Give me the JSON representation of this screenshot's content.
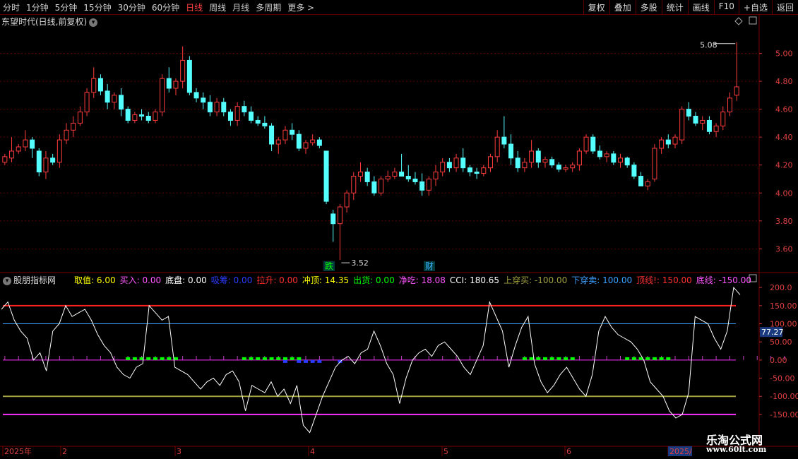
{
  "toolbar": {
    "periods": [
      "分时",
      "1分钟",
      "5分钟",
      "15分钟",
      "30分钟",
      "60分钟",
      "日线",
      "周线",
      "月线",
      "多周期",
      "更多"
    ],
    "active_period": "日线",
    "more_arrow": ">",
    "right_buttons": [
      "复权",
      "叠加",
      "多股",
      "统计",
      "画线",
      "F10",
      "+自选",
      "返回"
    ]
  },
  "stock": {
    "title": "东望时代(日线,前复权)",
    "dropdown_icon": "chevron-down-icon"
  },
  "price_panel": {
    "y_labels": [
      "5.00",
      "4.80",
      "4.60",
      "4.40",
      "4.20",
      "4.00",
      "3.80",
      "3.60"
    ],
    "y_values": [
      5.0,
      4.8,
      4.6,
      4.4,
      4.2,
      4.0,
      3.8,
      3.6
    ],
    "high_label": "5.08",
    "low_label": "3.52",
    "markers": [
      {
        "text": "跌",
        "color": "#00ff00"
      },
      {
        "text": "财",
        "color": "#3ab0ff"
      }
    ],
    "colors": {
      "up": "#ff3c3c",
      "down": "#54ffff",
      "grid": "#5a0000"
    }
  },
  "indicator": {
    "name": "股朋指标网",
    "fields": [
      {
        "label": "取值:",
        "value": "6.00",
        "color": "#ffff00"
      },
      {
        "label": "买入:",
        "value": "0.00",
        "color": "#ff55ff"
      },
      {
        "label": "底盘:",
        "value": "0.00",
        "color": "#ffffff"
      },
      {
        "label": "吸筹:",
        "value": "0.00",
        "color": "#2b3bff"
      },
      {
        "label": "拉升:",
        "value": "0.00",
        "color": "#ff3030"
      },
      {
        "label": "冲顶:",
        "value": "14.35",
        "color": "#ffff00"
      },
      {
        "label": "出货:",
        "value": "0.00",
        "color": "#00ff00"
      },
      {
        "label": "净吃:",
        "value": "18.08",
        "color": "#ff55ff"
      },
      {
        "label": "CCI:",
        "value": "180.65",
        "color": "#ffffff"
      },
      {
        "label": "上穿买:",
        "value": "-100.00",
        "color": "#a0a040"
      },
      {
        "label": "下穿卖:",
        "value": "100.00",
        "color": "#3aa0ff"
      },
      {
        "label": "顶线!:",
        "value": "150.00",
        "color": "#ff3030"
      },
      {
        "label": "底线:",
        "value": "-150.00",
        "color": "#ff55ff"
      }
    ],
    "y_labels": [
      "200.0",
      "150.00",
      "100.00",
      "50.00",
      "0.00",
      "-50.00",
      "-100.00",
      "-150.00"
    ],
    "y_values": [
      200,
      150,
      100,
      50,
      0,
      -50,
      -100,
      -150
    ],
    "current_cci_label": "77.27",
    "colors": {
      "top_line": "#ff2020",
      "sell_line": "#3aa0ff",
      "buy_line": "#a0a040",
      "bottom_line": "#ff30ff",
      "cci": "#ffffff"
    }
  },
  "x_axis": {
    "labels": [
      "2025年",
      "2",
      "3",
      "4",
      "5",
      "6",
      "2025/"
    ]
  },
  "watermark": {
    "line1": "乐淘公式网",
    "line2": "www.60lt.com"
  },
  "chart_data": [
    {
      "type": "candlestick",
      "title": "东望时代(日线,前复权)",
      "ylim": [
        3.45,
        5.2
      ],
      "candles": [
        [
          4.22,
          4.28,
          4.2,
          4.26
        ],
        [
          4.25,
          4.4,
          4.22,
          4.3
        ],
        [
          4.3,
          4.35,
          4.28,
          4.33
        ],
        [
          4.33,
          4.45,
          4.3,
          4.38
        ],
        [
          4.38,
          4.4,
          4.25,
          4.32
        ],
        [
          4.3,
          4.32,
          4.12,
          4.15
        ],
        [
          4.15,
          4.3,
          4.1,
          4.25
        ],
        [
          4.25,
          4.28,
          4.2,
          4.22
        ],
        [
          4.22,
          4.42,
          4.18,
          4.38
        ],
        [
          4.38,
          4.5,
          4.35,
          4.45
        ],
        [
          4.45,
          4.55,
          4.4,
          4.5
        ],
        [
          4.5,
          4.62,
          4.48,
          4.58
        ],
        [
          4.58,
          4.75,
          4.55,
          4.72
        ],
        [
          4.72,
          4.9,
          4.68,
          4.82
        ],
        [
          4.82,
          4.85,
          4.7,
          4.73
        ],
        [
          4.73,
          4.78,
          4.6,
          4.65
        ],
        [
          4.65,
          4.72,
          4.6,
          4.7
        ],
        [
          4.7,
          4.75,
          4.55,
          4.6
        ],
        [
          4.6,
          4.62,
          4.5,
          4.52
        ],
        [
          4.52,
          4.58,
          4.5,
          4.56
        ],
        [
          4.56,
          4.6,
          4.52,
          4.55
        ],
        [
          4.55,
          4.58,
          4.5,
          4.52
        ],
        [
          4.52,
          4.6,
          4.5,
          4.58
        ],
        [
          4.58,
          4.85,
          4.55,
          4.82
        ],
        [
          4.82,
          4.9,
          4.72,
          4.75
        ],
        [
          4.75,
          4.82,
          4.7,
          4.8
        ],
        [
          4.8,
          5.05,
          4.75,
          4.95
        ],
        [
          4.95,
          4.98,
          4.7,
          4.72
        ],
        [
          4.72,
          4.75,
          4.65,
          4.68
        ],
        [
          4.68,
          4.72,
          4.6,
          4.65
        ],
        [
          4.65,
          4.7,
          4.55,
          4.58
        ],
        [
          4.58,
          4.68,
          4.55,
          4.65
        ],
        [
          4.65,
          4.68,
          4.55,
          4.58
        ],
        [
          4.58,
          4.6,
          4.48,
          4.52
        ],
        [
          4.52,
          4.65,
          4.48,
          4.62
        ],
        [
          4.62,
          4.66,
          4.55,
          4.58
        ],
        [
          4.58,
          4.62,
          4.5,
          4.52
        ],
        [
          4.52,
          4.55,
          4.48,
          4.5
        ],
        [
          4.5,
          4.55,
          4.46,
          4.48
        ],
        [
          4.48,
          4.5,
          4.3,
          4.35
        ],
        [
          4.35,
          4.4,
          4.28,
          4.38
        ],
        [
          4.38,
          4.48,
          4.35,
          4.45
        ],
        [
          4.45,
          4.5,
          4.38,
          4.42
        ],
        [
          4.42,
          4.45,
          4.3,
          4.32
        ],
        [
          4.32,
          4.38,
          4.28,
          4.36
        ],
        [
          4.36,
          4.42,
          4.34,
          4.38
        ],
        [
          4.38,
          4.4,
          4.32,
          4.34
        ],
        [
          4.3,
          4.3,
          3.92,
          3.94
        ],
        [
          3.85,
          3.88,
          3.65,
          3.78
        ],
        [
          3.78,
          3.92,
          3.52,
          3.9
        ],
        [
          3.9,
          4.02,
          3.86,
          4.0
        ],
        [
          4.0,
          4.15,
          3.95,
          4.12
        ],
        [
          4.12,
          4.22,
          4.08,
          4.15
        ],
        [
          4.15,
          4.18,
          4.05,
          4.08
        ],
        [
          4.08,
          4.12,
          3.98,
          4.0
        ],
        [
          4.0,
          4.12,
          3.98,
          4.1
        ],
        [
          4.1,
          4.16,
          4.08,
          4.12
        ],
        [
          4.12,
          4.18,
          4.1,
          4.15
        ],
        [
          4.15,
          4.28,
          4.12,
          4.12
        ],
        [
          4.12,
          4.2,
          4.08,
          4.1
        ],
        [
          4.1,
          4.15,
          4.06,
          4.08
        ],
        [
          4.08,
          4.14,
          3.98,
          4.02
        ],
        [
          4.02,
          4.12,
          3.98,
          4.1
        ],
        [
          4.1,
          4.2,
          4.05,
          4.15
        ],
        [
          4.15,
          4.25,
          4.12,
          4.22
        ],
        [
          4.22,
          4.25,
          4.15,
          4.18
        ],
        [
          4.18,
          4.28,
          4.15,
          4.25
        ],
        [
          4.25,
          4.32,
          4.15,
          4.18
        ],
        [
          4.18,
          4.2,
          4.12,
          4.15
        ],
        [
          4.15,
          4.18,
          4.1,
          4.14
        ],
        [
          4.14,
          4.2,
          4.12,
          4.18
        ],
        [
          4.18,
          4.28,
          4.15,
          4.26
        ],
        [
          4.26,
          4.45,
          4.22,
          4.4
        ],
        [
          4.4,
          4.55,
          4.32,
          4.35
        ],
        [
          4.35,
          4.42,
          4.2,
          4.25
        ],
        [
          4.25,
          4.3,
          4.15,
          4.18
        ],
        [
          4.18,
          4.25,
          4.15,
          4.22
        ],
        [
          4.22,
          4.38,
          4.18,
          4.3
        ],
        [
          4.3,
          4.32,
          4.18,
          4.22
        ],
        [
          4.22,
          4.26,
          4.18,
          4.24
        ],
        [
          4.24,
          4.26,
          4.18,
          4.2
        ],
        [
          4.2,
          4.22,
          4.15,
          4.17
        ],
        [
          4.17,
          4.2,
          4.15,
          4.18
        ],
        [
          4.18,
          4.22,
          4.15,
          4.2
        ],
        [
          4.2,
          4.32,
          4.16,
          4.3
        ],
        [
          4.3,
          4.42,
          4.28,
          4.4
        ],
        [
          4.4,
          4.42,
          4.28,
          4.3
        ],
        [
          4.3,
          4.34,
          4.24,
          4.26
        ],
        [
          4.26,
          4.3,
          4.22,
          4.28
        ],
        [
          4.28,
          4.3,
          4.2,
          4.22
        ],
        [
          4.22,
          4.28,
          4.18,
          4.25
        ],
        [
          4.25,
          4.26,
          4.18,
          4.2
        ],
        [
          4.2,
          4.22,
          4.1,
          4.12
        ],
        [
          4.12,
          4.15,
          4.05,
          4.05
        ],
        [
          4.05,
          4.1,
          4.02,
          4.08
        ],
        [
          4.1,
          4.35,
          4.08,
          4.32
        ],
        [
          4.32,
          4.4,
          4.28,
          4.38
        ],
        [
          4.38,
          4.42,
          4.32,
          4.35
        ],
        [
          4.35,
          4.42,
          4.32,
          4.4
        ],
        [
          4.38,
          4.62,
          4.35,
          4.6
        ],
        [
          4.6,
          4.65,
          4.52,
          4.55
        ],
        [
          4.55,
          4.58,
          4.48,
          4.5
        ],
        [
          4.5,
          4.55,
          4.45,
          4.52
        ],
        [
          4.52,
          4.55,
          4.42,
          4.44
        ],
        [
          4.44,
          4.5,
          4.4,
          4.48
        ],
        [
          4.48,
          4.62,
          4.45,
          4.58
        ],
        [
          4.58,
          4.72,
          4.55,
          4.68
        ],
        [
          4.7,
          5.08,
          4.66,
          4.76
        ]
      ]
    },
    {
      "type": "line",
      "title": "股朋指标网",
      "ylim": [
        -230,
        210
      ],
      "series": [
        {
          "name": "CCI",
          "values": [
            140,
            160,
            110,
            80,
            60,
            0,
            20,
            -30,
            80,
            100,
            150,
            120,
            130,
            140,
            110,
            70,
            40,
            20,
            -20,
            -40,
            -50,
            -20,
            -10,
            150,
            130,
            110,
            120,
            -20,
            -30,
            -40,
            -60,
            -80,
            -60,
            -50,
            -70,
            -40,
            -30,
            -60,
            -140,
            -70,
            -80,
            -90,
            -60,
            -100,
            -80,
            -120,
            -70,
            -180,
            -200,
            -150,
            -100,
            -60,
            -20,
            0,
            10,
            -10,
            20,
            30,
            80,
            40,
            -10,
            -40,
            -120,
            -50,
            0,
            20,
            30,
            10,
            40,
            50,
            30,
            10,
            -20,
            -40,
            0,
            40,
            160,
            120,
            80,
            -20,
            40,
            90,
            120,
            -10,
            -60,
            -90,
            -70,
            -40,
            -20,
            -50,
            -80,
            -100,
            -40,
            80,
            120,
            90,
            70,
            60,
            50,
            30,
            0,
            -60,
            -80,
            -100,
            -140,
            -160,
            -150,
            -90,
            120,
            110,
            100,
            60,
            30,
            80,
            200,
            180
          ]
        }
      ]
    }
  ]
}
